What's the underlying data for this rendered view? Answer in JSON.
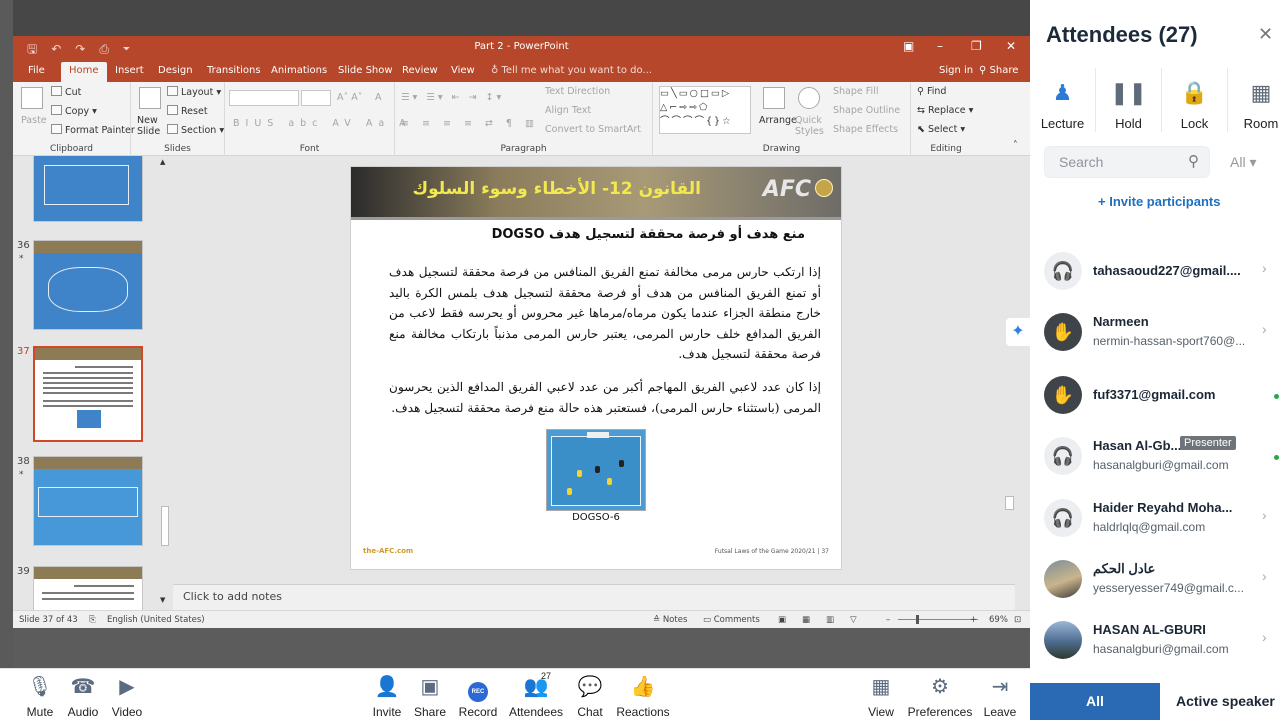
{
  "ppt": {
    "title": "Part 2 - PowerPoint",
    "tabs": [
      "File",
      "Home",
      "Insert",
      "Design",
      "Transitions",
      "Animations",
      "Slide Show",
      "Review",
      "View"
    ],
    "tell_me": "Tell me what you want to do...",
    "sign_in": "Sign in",
    "share": "Share",
    "ribbon": {
      "clipboard": {
        "paste": "Paste",
        "cut": "Cut",
        "copy": "Copy",
        "format_painter": "Format Painter",
        "label": "Clipboard"
      },
      "slides": {
        "new_slide": "New Slide",
        "layout": "Layout",
        "reset": "Reset",
        "section": "Section",
        "label": "Slides"
      },
      "font": {
        "label": "Font"
      },
      "paragraph": {
        "text_direction": "Text Direction",
        "align_text": "Align Text",
        "convert": "Convert to SmartArt",
        "label": "Paragraph"
      },
      "drawing": {
        "arrange": "Arrange",
        "quick_styles": "Quick Styles",
        "shape_fill": "Shape Fill",
        "shape_outline": "Shape Outline",
        "shape_effects": "Shape Effects",
        "label": "Drawing"
      },
      "editing": {
        "find": "Find",
        "replace": "Replace",
        "select": "Select",
        "label": "Editing"
      }
    },
    "thumbnails": [
      {
        "num": "",
        "starred": false,
        "selected": false
      },
      {
        "num": "36",
        "starred": true,
        "selected": false
      },
      {
        "num": "37",
        "starred": false,
        "selected": true
      },
      {
        "num": "38",
        "starred": true,
        "selected": false
      },
      {
        "num": "39",
        "starred": false,
        "selected": false
      }
    ],
    "slide": {
      "banner_title": "القانون 12- الأخطاء وسوء السلوك",
      "logo": "AFC",
      "heading": "منع هدف أو فرصة محققة لتسجيل هدف DOGSO",
      "para1": "إذا ارتكب حارس مرمى مخالفة تمنع الفريق المنافس من فرصة محققة لتسجيل هدف أو تمنع الفريق المنافس من هدف أو فرصة محققة لتسجيل هدف بلمس الكرة باليد خارج منطقة الجزاء عندما يكون مرماه/مرماها غير محروس أو يحرسه فقط لاعب من الفريق المدافع خلف حارس المرمى، يعتبر حارس المرمى مذنباً بارتكاب مخالفة منع فرصة محققة لتسجيل هدف.",
      "para2": "إذا كان عدد لاعبي الفريق المهاجم أكبر من عدد لاعبي الفريق المدافع الذين يحرسون المرمى (باستثناء حارس المرمى)، فستعتبر هذه حالة منع فرصة محققة لتسجيل هدف.",
      "caption": "DOGSO-6",
      "footer_left": "the-AFC.com",
      "footer_right": "Futsal Laws of the Game 2020/21 | 37"
    },
    "notes_placeholder": "Click to add notes",
    "status": {
      "slide_of": "Slide 37 of 43",
      "language": "English (United States)",
      "notes": "Notes",
      "comments": "Comments",
      "zoom": "69%",
      "zoom_level": 0.69
    }
  },
  "toolbar": {
    "buttons": [
      {
        "label": "Mute",
        "icon": "microphone-icon"
      },
      {
        "label": "Audio",
        "icon": "phone-icon"
      },
      {
        "label": "Video",
        "icon": "video-camera-icon"
      },
      {
        "label": "Invite",
        "icon": "add-person-icon"
      },
      {
        "label": "Share",
        "icon": "share-screen-icon"
      },
      {
        "label": "Record",
        "icon": "record-icon"
      },
      {
        "label": "Attendees",
        "icon": "people-icon",
        "count": "27"
      },
      {
        "label": "Chat",
        "icon": "chat-icon"
      },
      {
        "label": "Reactions",
        "icon": "thumbs-up-icon"
      },
      {
        "label": "View",
        "icon": "layout-icon"
      },
      {
        "label": "Preferences",
        "icon": "gear-icon"
      },
      {
        "label": "Leave",
        "icon": "exit-icon"
      }
    ],
    "record_badge": "REC"
  },
  "panel": {
    "title": "Attendees (27)",
    "controls": [
      {
        "label": "Lecture",
        "icon": "lectern-icon"
      },
      {
        "label": "Hold",
        "icon": "pause-icon"
      },
      {
        "label": "Lock",
        "icon": "lock-icon"
      },
      {
        "label": "Room",
        "icon": "grid-icon"
      }
    ],
    "search_placeholder": "Search",
    "filter": "All",
    "invite": "Invite participants",
    "attendees": [
      {
        "name": "tahasaoud227@gmail....",
        "email": "",
        "avatar": "headset",
        "presenter": false
      },
      {
        "name": "Narmeen",
        "email": "nermin-hassan-sport760@...",
        "avatar": "hand",
        "presenter": false
      },
      {
        "name": "fuf3371@gmail.com",
        "email": "",
        "avatar": "hand",
        "presenter": false
      },
      {
        "name": "Hasan Al-Gb...",
        "email": "hasanalgburi@gmail.com",
        "avatar": "headset",
        "presenter": true
      },
      {
        "name": "Haider Reyahd Moha...",
        "email": "haldrlqlq@gmail.com",
        "avatar": "headset",
        "presenter": false
      },
      {
        "name": "عادل الحكم",
        "email": "yesseryesser749@gmail.c...",
        "avatar": "photo1",
        "presenter": false
      },
      {
        "name": "HASAN AL-GBURI",
        "email": "hasanalgburi@gmail.com",
        "avatar": "photo2",
        "presenter": false
      }
    ],
    "presenter_badge": "Presenter",
    "tabs": {
      "all": "All",
      "active": "Active speaker"
    }
  }
}
